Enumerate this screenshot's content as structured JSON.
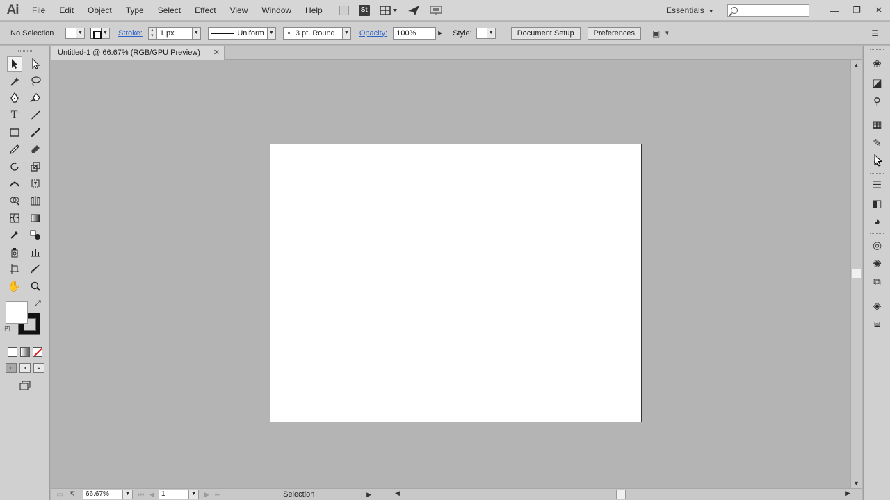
{
  "menubar": {
    "logo": "Ai",
    "items": [
      "File",
      "Edit",
      "Object",
      "Type",
      "Select",
      "Effect",
      "View",
      "Window",
      "Help"
    ],
    "stock_badge": "St",
    "workspace": "Essentials",
    "search_placeholder": "",
    "window_controls": {
      "minimize": "—",
      "restore": "❐",
      "close": "✕"
    }
  },
  "controlbar": {
    "selection_label": "No Selection",
    "stroke_label": "Stroke:",
    "stroke_weight": "1 px",
    "profile_label": "Uniform",
    "brush_label": "3 pt. Round",
    "opacity_label": "Opacity:",
    "opacity_value": "100%",
    "style_label": "Style:",
    "document_setup": "Document Setup",
    "preferences": "Preferences"
  },
  "document": {
    "tab_title": "Untitled-1 @ 66.67% (RGB/GPU Preview)",
    "tab_close": "✕"
  },
  "statusbar": {
    "zoom": "66.67%",
    "artboard_number": "1",
    "current_tool": "Selection"
  },
  "colors": {
    "chrome": "#d0d0d0",
    "pasteboard": "#b4b4b4",
    "artboard": "#ffffff",
    "link_blue": "#2c63c9"
  },
  "tools": [
    [
      "selection-tool",
      "direct-selection-tool"
    ],
    [
      "magic-wand-tool",
      "lasso-tool"
    ],
    [
      "pen-tool",
      "curvature-tool"
    ],
    [
      "type-tool",
      "line-segment-tool"
    ],
    [
      "rectangle-tool",
      "paintbrush-tool"
    ],
    [
      "pencil-tool",
      "eraser-tool"
    ],
    [
      "rotate-tool",
      "scale-tool"
    ],
    [
      "width-tool",
      "free-transform-tool"
    ],
    [
      "shape-builder-tool",
      "perspective-grid-tool"
    ],
    [
      "mesh-tool",
      "gradient-tool"
    ],
    [
      "eyedropper-tool",
      "blend-tool"
    ],
    [
      "symbol-sprayer-tool",
      "column-graph-tool"
    ],
    [
      "artboard-tool",
      "slice-tool"
    ],
    [
      "hand-tool",
      "zoom-tool"
    ]
  ],
  "dock": [
    "color-guide-icon",
    "libraries-icon",
    "cc-libraries-icon",
    "swatches-icon",
    "brushes-icon",
    "symbols-icon",
    "stroke-icon",
    "gradient-icon",
    "transparency-icon",
    "appearance-icon",
    "graphic-styles-icon",
    "asset-export-icon",
    "layers-icon",
    "artboards-icon"
  ]
}
